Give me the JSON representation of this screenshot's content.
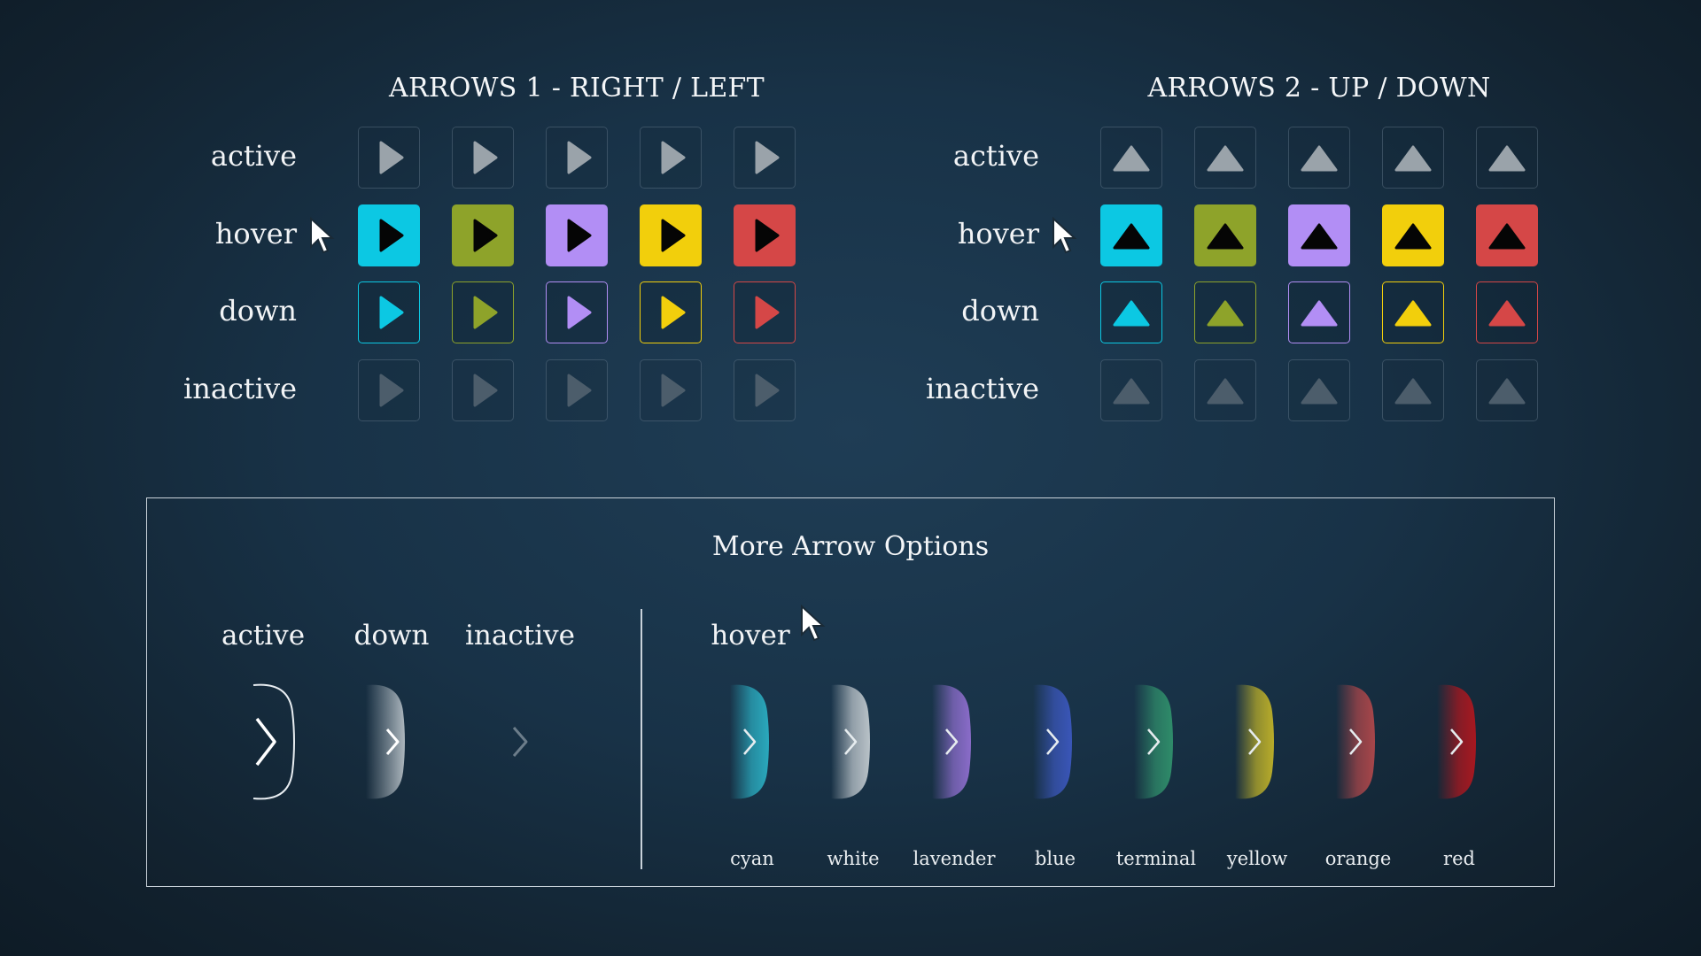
{
  "arrows1": {
    "title": "ARROWS 1 - RIGHT / LEFT",
    "rows": {
      "active": "active",
      "hover": "hover",
      "down": "down",
      "inactive": "inactive"
    }
  },
  "arrows2": {
    "title": "ARROWS 2 - UP / DOWN",
    "rows": {
      "active": "active",
      "hover": "hover",
      "down": "down",
      "inactive": "inactive"
    }
  },
  "colors": {
    "active_gray": "#9aa3aa",
    "inactive_gray": "#4c5d6b",
    "cyan": "#0cc8e3",
    "olive": "#8ea32a",
    "lavender": "#b28ef5",
    "yellow": "#f2cf0c",
    "red": "#d54747"
  },
  "more_options": {
    "title": "More Arrow Options",
    "states": {
      "active": "active",
      "down": "down",
      "inactive": "inactive",
      "hover": "hover"
    },
    "hover_colors": [
      {
        "label": "cyan",
        "color": "#2aa9bd"
      },
      {
        "label": "white",
        "color": "#b9c2c8"
      },
      {
        "label": "lavender",
        "color": "#8a6cc9"
      },
      {
        "label": "blue",
        "color": "#3a56b8"
      },
      {
        "label": "terminal",
        "color": "#2f8c6a"
      },
      {
        "label": "yellow",
        "color": "#b8ac2a"
      },
      {
        "label": "orange",
        "color": "#a8464a"
      },
      {
        "label": "red",
        "color": "#a81820"
      }
    ]
  },
  "icons": {
    "arrow_right": "play-right-icon",
    "arrow_up": "triangle-up-icon",
    "cursor": "mouse-pointer-icon",
    "chevron": "chevron-right-icon"
  }
}
